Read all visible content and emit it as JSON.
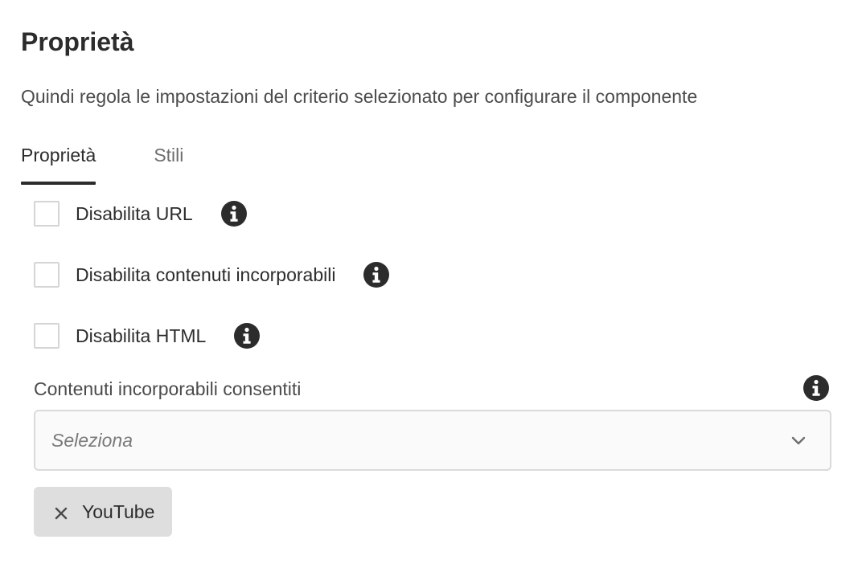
{
  "header": {
    "title": "Proprietà",
    "description": "Quindi regola le impostazioni del criterio selezionato per configurare il componente"
  },
  "tabs": [
    {
      "label": "Proprietà",
      "selected": true
    },
    {
      "label": "Stili",
      "selected": false
    }
  ],
  "options": [
    {
      "label": "Disabilita URL",
      "checked": false,
      "icon": "info-icon"
    },
    {
      "label": "Disabilita contenuti incorporabili",
      "checked": false,
      "icon": "info-icon"
    },
    {
      "label": "Disabilita HTML",
      "checked": false,
      "icon": "info-icon"
    }
  ],
  "embeddables": {
    "label": "Contenuti incorporabili consentiti",
    "placeholder": "Seleziona",
    "icon": "chevron-down-icon",
    "selected_tags": [
      {
        "label": "YouTube",
        "remove_icon": "close-icon"
      }
    ]
  },
  "colors": {
    "text": "#2c2c2c",
    "muted": "#6e6e6e",
    "tag_bg": "#dedede",
    "border": "#dadada"
  }
}
